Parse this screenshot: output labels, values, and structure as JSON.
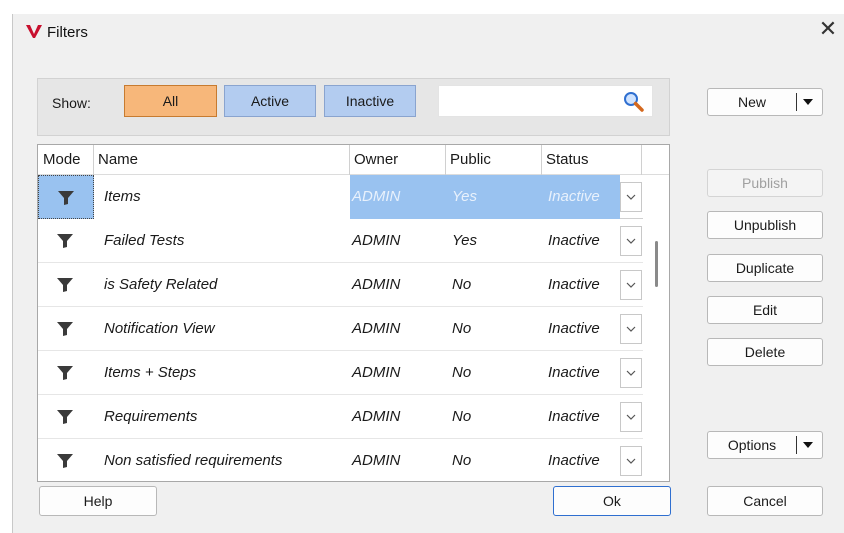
{
  "window": {
    "title": "Filters",
    "close_label": "✕"
  },
  "colors": {
    "all_selected": "#f7b77a",
    "toggle_blue": "#b3ccf0",
    "row_selected": "#99c2f0"
  },
  "show_bar": {
    "label": "Show:",
    "buttons": [
      "All",
      "Active",
      "Inactive"
    ],
    "selected": "All",
    "search": {
      "value": "",
      "placeholder": ""
    }
  },
  "table": {
    "columns": [
      "Mode",
      "Name",
      "Owner",
      "Public",
      "Status"
    ],
    "rows": [
      {
        "name": "Items",
        "owner": "ADMIN",
        "public": "Yes",
        "status": "Inactive",
        "selected": true
      },
      {
        "name": "Failed Tests",
        "owner": "ADMIN",
        "public": "Yes",
        "status": "Inactive"
      },
      {
        "name": "is Safety Related",
        "owner": "ADMIN",
        "public": "No",
        "status": "Inactive"
      },
      {
        "name": "Notification View",
        "owner": "ADMIN",
        "public": "No",
        "status": "Inactive"
      },
      {
        "name": "Items + Steps",
        "owner": "ADMIN",
        "public": "No",
        "status": "Inactive"
      },
      {
        "name": "Requirements",
        "owner": "ADMIN",
        "public": "No",
        "status": "Inactive"
      },
      {
        "name": "Non satisfied requirements",
        "owner": "ADMIN",
        "public": "No",
        "status": "Inactive"
      }
    ]
  },
  "side_buttons": {
    "new": "New",
    "publish": "Publish",
    "unpublish": "Unpublish",
    "duplicate": "Duplicate",
    "edit": "Edit",
    "delete": "Delete",
    "options": "Options"
  },
  "footer": {
    "help": "Help",
    "ok": "Ok",
    "cancel": "Cancel"
  }
}
